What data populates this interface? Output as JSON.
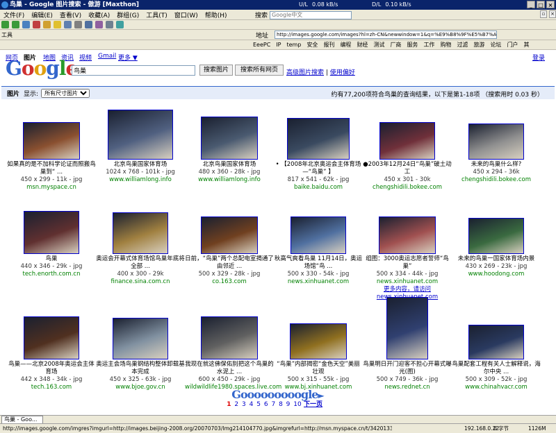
{
  "window": {
    "title": "鸟巢 - Google 图片搜索 - 傲游 [Maxthon]",
    "ul": "U/L",
    "dl": "D/L",
    "ul_rate": "0.08 kB/s",
    "dl_rate": "0.10 kB/s"
  },
  "menu": [
    "文件(F)",
    "编辑(E)",
    "查看(V)",
    "收藏(A)",
    "群组(G)",
    "工具(T)",
    "窗口(W)",
    "帮助(H)"
  ],
  "search": {
    "label": "搜索",
    "placeholder": "Google中文"
  },
  "address": {
    "label": "地址",
    "url": "http://images.google.com/images?hl=zh-CN&newwindow=1&q=%E9%B8%9F%E5%B7%A2"
  },
  "links": {
    "label": "工具",
    "items": [
      "EeePC",
      "IP",
      "temp",
      "安全",
      "报刊",
      "编程",
      "财经",
      "测试",
      "厂商",
      "服务",
      "工作",
      "购物",
      "过滤",
      "旅游",
      "论坛",
      "门户",
      "其"
    ]
  },
  "google": {
    "nav": [
      "网页",
      "图片",
      "地图",
      "资讯",
      "视频",
      "Gmail",
      "更多 ▼"
    ],
    "login": "登录",
    "logo": "Google",
    "query": "鸟巢",
    "btn_search": "搜索图片",
    "btn_all": "搜索所有网页",
    "adv": "高级图片搜索",
    "prefs": "使用偏好",
    "sep": "|",
    "results_label": "图片",
    "display_label": "显示:",
    "size_option": "所有尺寸图片",
    "summary": "约有77,200项符合鸟巢的查询结果，以下是第1-18项 （搜索用时 0.03 秒）"
  },
  "results": [
    {
      "cap": "如果真的是不加科学论证而照搬鸟巢到“ ...",
      "dim": "450 x 299 - 11k - jpg",
      "site": "msn.myspace.cn",
      "c": "#8a5030"
    },
    {
      "cap": "北京鸟巢国家体育场",
      "dim": "1024 x 768 - 101k - jpg",
      "site": "www.williamlong.info",
      "c": "#506080"
    },
    {
      "cap": "北京鸟巢国家体育场",
      "dim": "480 x 360 - 28k - jpg",
      "site": "www.williamlong.info",
      "c": "#4a5a70"
    },
    {
      "cap": "• 【2008年北京奥运会主体育场—“鸟巢” 】",
      "dim": "817 x 541 - 62k - jpg",
      "site": "baike.baidu.com",
      "c": "#3a4a60"
    },
    {
      "cap": "●2003年12月24日“鸟巢”破土动工",
      "dim": "450 x 301 - 30k",
      "site": "chengshidili.bokee.com",
      "c": "#70303a"
    },
    {
      "cap": "未来的鸟巢什么样?",
      "dim": "450 x 294 - 36k",
      "site": "chengshidili.bokee.com",
      "c": "#909090"
    },
    {
      "cap": "鸟巢",
      "dim": "440 x 346 - 29k - jpg",
      "site": "tech.enorth.com.cn",
      "c": "#603030"
    },
    {
      "cap": "奥运会开幕式体育场馆鸟巢年底将全部 ...",
      "dim": "400 x 300 - 29k",
      "site": "finance.sina.com.cn",
      "c": "#a08040"
    },
    {
      "cap": "日前，“鸟巢”两个总配电室揭通了由邻近 ...",
      "dim": "500 x 329 - 28k - jpg",
      "site": "co.163.com",
      "c": "#704020"
    },
    {
      "cap": "秋高气爽看鸟巢 11月14日，奥运场馆“鸟 ...",
      "dim": "500 x 330 - 54k - jpg",
      "site": "news.xinhuanet.com",
      "c": "#5070a0"
    },
    {
      "cap": "组图：3000奥运志愿者誓师“鸟巢”",
      "dim": "500 x 334 - 44k - jpg",
      "site": "news.xinhuanet.com",
      "more": "更多内容，请访问",
      "more_site": "news.xinhuanet.com",
      "c": "#a05050"
    },
    {
      "cap": "未来的鸟巢一国家体育场内景",
      "dim": "430 x 269 - 23k - jpg",
      "site": "www.hoodong.com",
      "c": "#3a6a40"
    },
    {
      "cap": "鸟巢——北京2008年奥运会主体育场",
      "dim": "442 x 348 - 34k - jpg",
      "site": "tech.163.com",
      "c": "#503020"
    },
    {
      "cap": "奥运主会场鸟巢钢结构整体卸载基本完成",
      "dim": "450 x 325 - 63k - jpg",
      "site": "www.bjoe.gov.cn",
      "c": "#8090a0"
    },
    {
      "cap": "我现在就这佛保佑别把这个鸟巢的水泥上 ...",
      "dim": "600 x 450 - 29k - jpg",
      "site": "wildwildlife1980.spaces.live.com",
      "c": "#606060"
    },
    {
      "cap": "“鸟巢”内部揭密“金色天空”美丽壮观",
      "dim": "500 x 315 - 55k - jpg",
      "site": "www.bj.xinhuanet.com",
      "c": "#907020"
    },
    {
      "cap": "鸟巢明日开门迎客不担心开幕式曝光(图)",
      "dim": "500 x 749 - 36k - jpg",
      "site": "news.rednet.cn",
      "c": "#304070"
    },
    {
      "cap": "鸟巢配套工程有关人士解释说，海尔中央 ...",
      "dim": "500 x 309 - 52k - jpg",
      "site": "www.chinahvacr.com",
      "c": "#2a3a60"
    }
  ],
  "pager": {
    "goo": "Gooooooooogle",
    "next_arrow": "►",
    "pages": [
      "1",
      "2",
      "3",
      "4",
      "5",
      "6",
      "7",
      "8",
      "9",
      "10"
    ],
    "next": "下一页"
  },
  "tab": "鸟巢 - Goo...",
  "status": {
    "url": "http://images.google.com/imgres?imgurl=http://images.beijing-2008.org/20070703/Img214104770.jpg&imgrefurl=http://msn.myspace.cn/t/3420133.b",
    "ip": "192.168.0.22",
    "bytes": "0 字节",
    "mem": "1126M"
  }
}
